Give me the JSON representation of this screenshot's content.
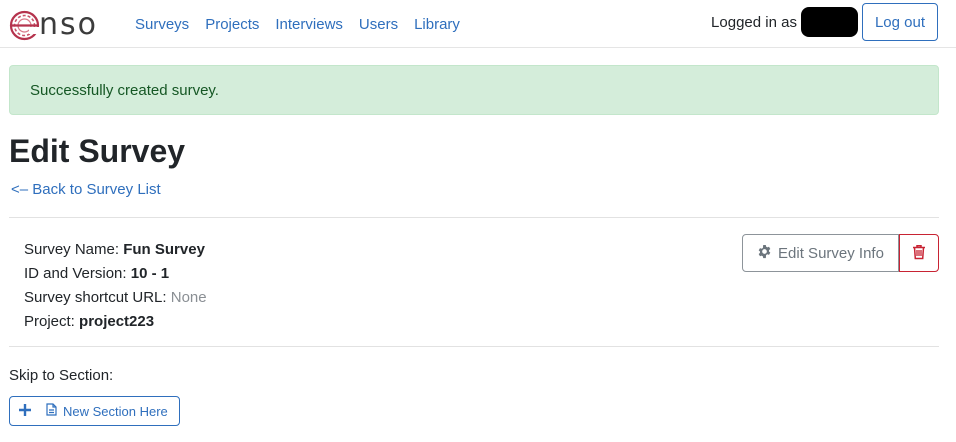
{
  "brand": {
    "logo_text": "nso",
    "logo_letter": "e"
  },
  "nav": {
    "links": [
      "Surveys",
      "Projects",
      "Interviews",
      "Users",
      "Library"
    ]
  },
  "auth": {
    "logged_in_label": "Logged in as",
    "logout_label": "Log out"
  },
  "alert": {
    "message": "Successfully created survey.",
    "type": "success"
  },
  "page": {
    "title": "Edit Survey",
    "back_link": "<– Back to Survey List"
  },
  "survey_info": {
    "name_label": "Survey Name:",
    "name_value": "Fun Survey",
    "id_label": "ID and Version:",
    "id_value": "10 - 1",
    "shortcut_label": "Survey shortcut URL:",
    "shortcut_value": "None",
    "project_label": "Project:",
    "project_value": "project223"
  },
  "actions": {
    "edit_label": "Edit Survey Info",
    "edit_icon": "gear-icon",
    "delete_icon": "trash-icon"
  },
  "sections": {
    "skip_label": "Skip to Section:",
    "new_section_label": "New Section Here"
  },
  "colors": {
    "primary": "#2f6fbd",
    "danger": "#c82333",
    "success_bg": "#d4edda",
    "success_text": "#155724",
    "muted": "#6c757d"
  }
}
